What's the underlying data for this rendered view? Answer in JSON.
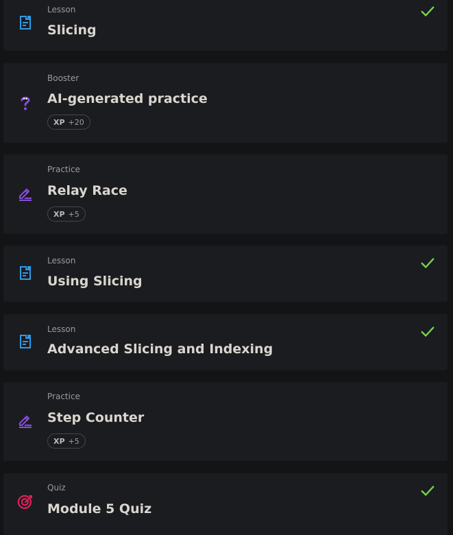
{
  "items": [
    {
      "type": "Lesson",
      "title": "Slicing",
      "xp": null,
      "done": true
    },
    {
      "type": "Booster",
      "title": "AI-generated practice",
      "xp": "+20",
      "done": false
    },
    {
      "type": "Practice",
      "title": "Relay Race",
      "xp": "+5",
      "done": false
    },
    {
      "type": "Lesson",
      "title": "Using Slicing",
      "xp": null,
      "done": true
    },
    {
      "type": "Lesson",
      "title": "Advanced Slicing and Indexing",
      "xp": null,
      "done": true
    },
    {
      "type": "Practice",
      "title": "Step Counter",
      "xp": "+5",
      "done": false
    },
    {
      "type": "Quiz",
      "title": "Module 5 Quiz",
      "xp": null,
      "done": true
    }
  ],
  "xp_label": "XP",
  "icons": {
    "lesson": "document-icon",
    "booster": "question-mark-icon",
    "practice": "pencil-icon",
    "quiz": "target-icon",
    "done": "checkmark-icon"
  },
  "colors": {
    "lesson": "#2e9be8",
    "booster": "#8a4de0",
    "practice": "#8a4de0",
    "quiz": "#e0205c",
    "check": "#78d64b"
  }
}
